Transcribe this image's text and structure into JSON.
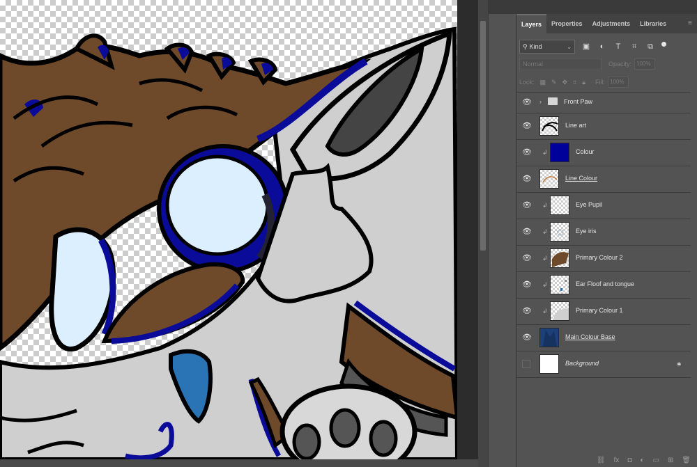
{
  "panel": {
    "tabs": [
      {
        "label": "Layers",
        "active": true
      },
      {
        "label": "Properties",
        "active": false
      },
      {
        "label": "Adjustments",
        "active": false
      },
      {
        "label": "Libraries",
        "active": false
      }
    ],
    "filter_kind": "Kind",
    "blend_mode": "Normal",
    "opacity_label": "Opacity:",
    "opacity_value": "100%",
    "lock_label": "Lock:",
    "fill_label": "Fill:",
    "fill_value": "100%"
  },
  "layers": [
    {
      "name": "Front Paw",
      "type": "group",
      "visible": true,
      "clipped": false
    },
    {
      "name": "Line art",
      "type": "layer",
      "visible": true,
      "clipped": false
    },
    {
      "name": "Colour",
      "type": "fill",
      "visible": true,
      "clipped": true,
      "color": "#00009a"
    },
    {
      "name": "Line Colour",
      "type": "layer",
      "visible": true,
      "clipped": false,
      "underline": true
    },
    {
      "name": "Eye Pupil",
      "type": "layer",
      "visible": true,
      "clipped": true
    },
    {
      "name": "Eye iris",
      "type": "layer",
      "visible": true,
      "clipped": true
    },
    {
      "name": "Primary Colour 2",
      "type": "layer",
      "visible": true,
      "clipped": true
    },
    {
      "name": "Ear Floof and tongue",
      "type": "layer",
      "visible": true,
      "clipped": true
    },
    {
      "name": "Primary Colour 1",
      "type": "layer",
      "visible": true,
      "clipped": true
    },
    {
      "name": "Main Colour Base",
      "type": "layer",
      "visible": true,
      "clipped": false,
      "underline": true
    },
    {
      "name": "Background",
      "type": "background",
      "visible": false,
      "clipped": false,
      "italic": true,
      "locked": true
    }
  ],
  "colors": {
    "brown": "#6e4a2a",
    "blue_outline": "#0b0b9a",
    "gray_fur": "#cfcfcf",
    "eye_white": "#dcefff",
    "tongue": "#2a73b5"
  }
}
